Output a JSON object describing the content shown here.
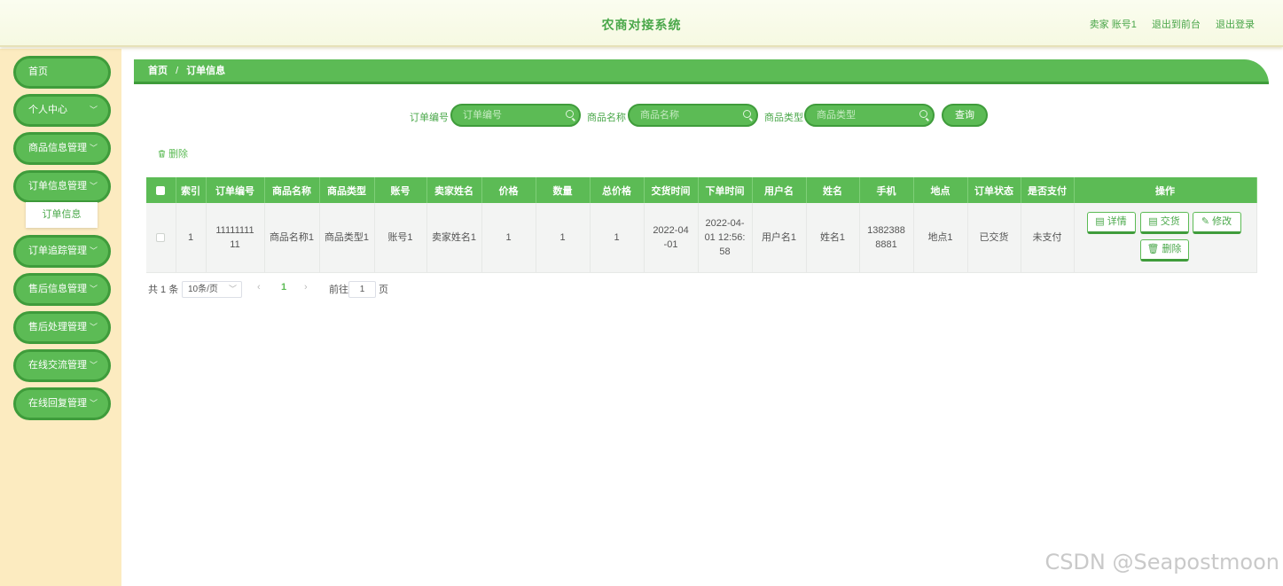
{
  "header": {
    "title": "农商对接系统",
    "user_label": "卖家 账号1",
    "back_to_front": "退出到前台",
    "logout": "退出登录"
  },
  "sidebar": {
    "items": [
      {
        "label": "首页",
        "has_arrow": false
      },
      {
        "label": "个人中心",
        "has_arrow": true
      },
      {
        "label": "商品信息管理",
        "has_arrow": true
      },
      {
        "label": "订单信息管理",
        "has_arrow": true
      },
      {
        "label": "订单追踪管理",
        "has_arrow": true
      },
      {
        "label": "售后信息管理",
        "has_arrow": true
      },
      {
        "label": "售后处理管理",
        "has_arrow": true
      },
      {
        "label": "在线交流管理",
        "has_arrow": true
      },
      {
        "label": "在线回复管理",
        "has_arrow": true
      }
    ],
    "submenu": {
      "label": "订单信息"
    },
    "arrow_glyph": "﹀"
  },
  "breadcrumb": {
    "home": "首页",
    "separator": "/",
    "current": "订单信息"
  },
  "search": {
    "order_no_label": "订单编号",
    "order_no_placeholder": "订单编号",
    "product_name_label": "商品名称",
    "product_name_placeholder": "商品名称",
    "product_type_label": "商品类型",
    "product_type_placeholder": "商品类型",
    "query_button": "查询"
  },
  "toolbar": {
    "delete_label": "删除",
    "delete_icon": "trash-icon"
  },
  "table": {
    "headers": [
      "索引",
      "订单编号",
      "商品名称",
      "商品类型",
      "账号",
      "卖家姓名",
      "价格",
      "数量",
      "总价格",
      "交货时间",
      "下单时间",
      "用户名",
      "姓名",
      "手机",
      "地点",
      "订单状态",
      "是否支付",
      "操作"
    ],
    "rows": [
      {
        "cells": [
          "1",
          "1111111111",
          "商品名称1",
          "商品类型1",
          "账号1",
          "卖家姓名1",
          "1",
          "1",
          "1",
          "2022-04-01",
          "2022-04-01 12:56:58",
          "用户名1",
          "姓名1",
          "13823888881",
          "地点1",
          "已交货",
          "未支付"
        ],
        "actions": {
          "detail": "详情",
          "deliver": "交货",
          "edit": "修改",
          "delete": "删除"
        }
      }
    ]
  },
  "pagination": {
    "total": "共 1 条",
    "page_size": "10条/页",
    "prev": "‹",
    "current_page": "1",
    "next": "›",
    "goto_label": "前往",
    "goto_value": "1",
    "page_suffix": "页"
  },
  "watermark": "CSDN @Seapostmoon",
  "colors": {
    "accent": "#5cbb55",
    "accent_dark": "#3f9c3b",
    "sidebar_bg": "#fcebc0",
    "header_bg": "#f8fae8"
  }
}
